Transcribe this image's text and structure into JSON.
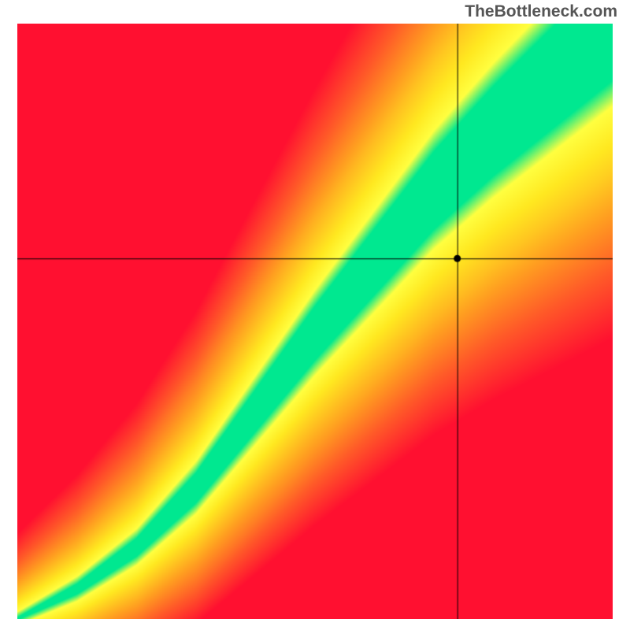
{
  "watermark": "TheBottleneck.com",
  "chart_data": {
    "type": "heatmap",
    "title": "",
    "xlabel": "",
    "ylabel": "",
    "x_range": [
      0,
      1
    ],
    "y_range": [
      0,
      1
    ],
    "crosshair": {
      "x": 0.74,
      "y": 0.605
    },
    "ideal_curve": {
      "points": [
        {
          "x": 0.0,
          "y": 0.0
        },
        {
          "x": 0.1,
          "y": 0.05
        },
        {
          "x": 0.2,
          "y": 0.12
        },
        {
          "x": 0.3,
          "y": 0.22
        },
        {
          "x": 0.4,
          "y": 0.35
        },
        {
          "x": 0.5,
          "y": 0.48
        },
        {
          "x": 0.6,
          "y": 0.6
        },
        {
          "x": 0.7,
          "y": 0.72
        },
        {
          "x": 0.8,
          "y": 0.82
        },
        {
          "x": 0.9,
          "y": 0.91
        },
        {
          "x": 1.0,
          "y": 1.0
        }
      ],
      "width_profile": [
        {
          "x": 0.0,
          "w": 0.002
        },
        {
          "x": 0.2,
          "w": 0.015
        },
        {
          "x": 0.4,
          "w": 0.035
        },
        {
          "x": 0.6,
          "w": 0.055
        },
        {
          "x": 0.8,
          "w": 0.075
        },
        {
          "x": 1.0,
          "w": 0.095
        }
      ]
    },
    "color_scale": [
      {
        "stop": 0.0,
        "color": "#ff1030"
      },
      {
        "stop": 0.3,
        "color": "#ff5a28"
      },
      {
        "stop": 0.55,
        "color": "#ffa020"
      },
      {
        "stop": 0.8,
        "color": "#ffe820"
      },
      {
        "stop": 0.92,
        "color": "#ffff40"
      },
      {
        "stop": 1.0,
        "color": "#00e890"
      }
    ]
  }
}
